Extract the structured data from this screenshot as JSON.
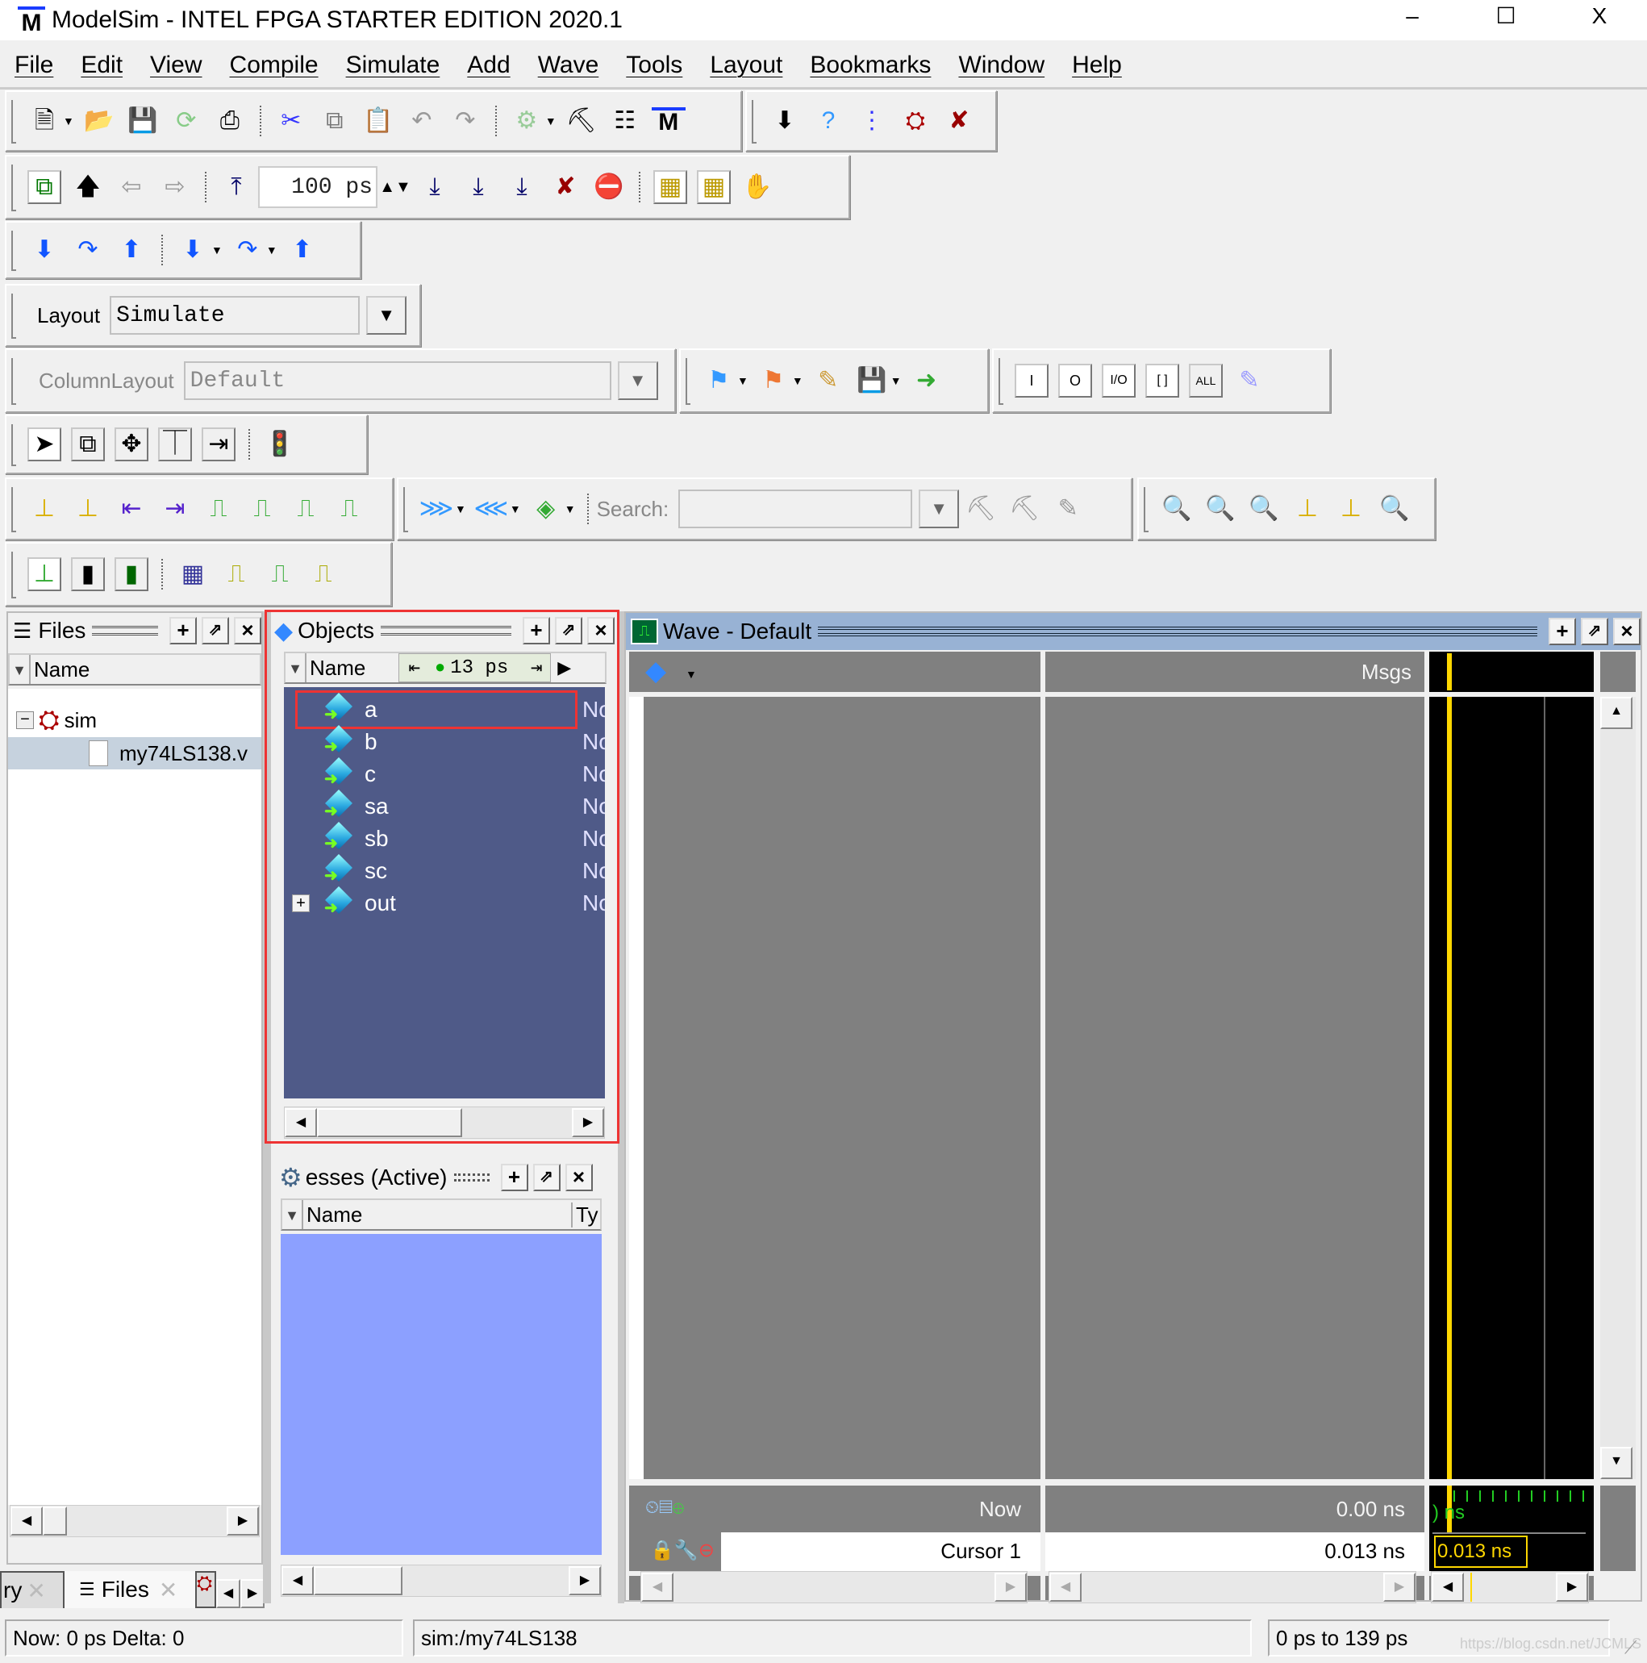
{
  "window": {
    "title": "ModelSim - INTEL FPGA STARTER EDITION 2020.1",
    "logo": "M",
    "minimize": "–",
    "maximize": "☐",
    "close": "X"
  },
  "menu": [
    "File",
    "Edit",
    "View",
    "Compile",
    "Simulate",
    "Add",
    "Wave",
    "Tools",
    "Layout",
    "Bookmarks",
    "Window",
    "Help"
  ],
  "toolbar": {
    "run_length_value": "100 ps",
    "layout_label": "Layout",
    "layout_value": "Simulate",
    "column_layout_label": "ColumnLayout",
    "column_layout_value": "Default",
    "search_label": "Search:",
    "search_value": "",
    "filter_buttons": [
      "I",
      "O",
      "I/O",
      "[ ]",
      "ALL"
    ]
  },
  "files_pane": {
    "title": "Files",
    "column_name": "Name",
    "tree": [
      {
        "label": "sim",
        "expanded": true,
        "toggle": "−"
      },
      {
        "label": "my74LS138.v"
      }
    ],
    "tabs": [
      "ry",
      "Files"
    ]
  },
  "objects_pane": {
    "title": "Objects",
    "column_name": "Name",
    "time_value": "13 ps",
    "signals": [
      {
        "name": "a",
        "value": "No",
        "selected_box": true
      },
      {
        "name": "b",
        "value": "No"
      },
      {
        "name": "c",
        "value": "No"
      },
      {
        "name": "sa",
        "value": "No"
      },
      {
        "name": "sb",
        "value": "No"
      },
      {
        "name": "sc",
        "value": "No"
      },
      {
        "name": "out",
        "value": "No",
        "expandable": true
      }
    ]
  },
  "processes_pane": {
    "title": "esses (Active)",
    "column_name": "Name",
    "column_type": "Ty"
  },
  "wave_pane": {
    "title": "Wave - Default",
    "msgs_label": "Msgs",
    "now_label": "Now",
    "now_value": "0.00 ns",
    "cursor_label": "Cursor 1",
    "cursor_value": "0.013 ns",
    "cursor_marker": "0.013 ns",
    "timeline_label": ") ns",
    "cursor_color": "#ffd700"
  },
  "status_bar": {
    "now_delta": "Now: 0 ps  Delta: 0",
    "context": "sim:/my74LS138",
    "range": "0 ps to 139 ps",
    "watermark": "https://blog.csdn.net/JCMLS"
  }
}
